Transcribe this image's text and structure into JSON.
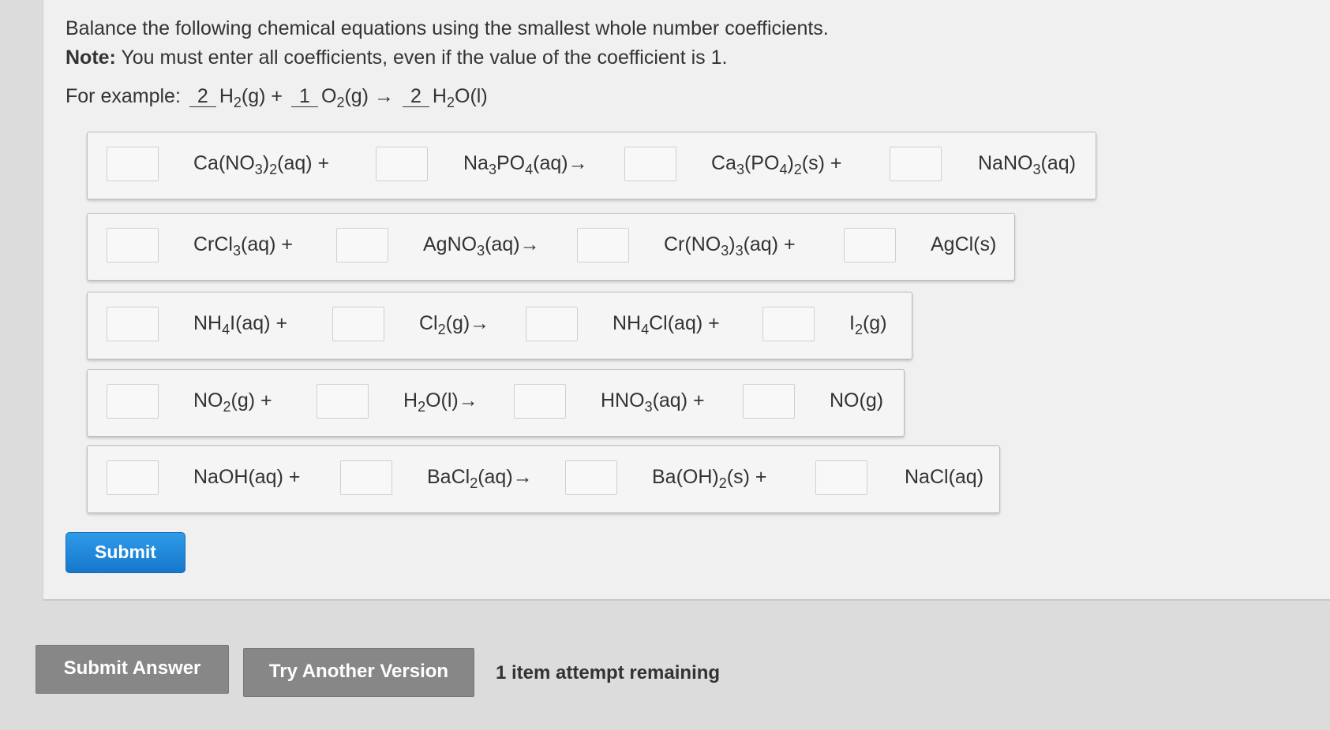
{
  "instructions": {
    "line1": "Balance the following chemical equations using the smallest whole number coefficients.",
    "note_label": "Note:",
    "note_text": " You must enter all coefficients, even if the value of the coefficient is 1."
  },
  "example": {
    "label": "For example:",
    "c1": "2",
    "s1_a": "H",
    "s1_sub": "2",
    "s1_b": "(g) +",
    "c2": "1",
    "s2_a": "O",
    "s2_sub": "2",
    "s2_b": "(g)",
    "arrow": "→",
    "c3": "2",
    "s3_a": "H",
    "s3_sub": "2",
    "s3_b": "O(l)"
  },
  "equations": [
    {
      "r1": "Ca(NO3)2(aq) +",
      "r2": "Na3PO4(aq)→",
      "p1": "Ca3(PO4)2(s) +",
      "p2": "NaNO3(aq)"
    },
    {
      "r1": "CrCl3(aq) +",
      "r2": "AgNO3(aq)→",
      "p1": "Cr(NO3)3(aq) +",
      "p2": "AgCl(s)"
    },
    {
      "r1": "NH4I(aq) +",
      "r2": "Cl2(g)→",
      "p1": "NH4Cl(aq) +",
      "p2": "I2(g)"
    },
    {
      "r1": "NO2(g) +",
      "r2": "H2O(l)→",
      "p1": "HNO3(aq) +",
      "p2": "NO(g)"
    },
    {
      "r1": "NaOH(aq) +",
      "r2": "BaCl2(aq)→",
      "p1": "Ba(OH)2(s) +",
      "p2": "NaCl(aq)"
    }
  ],
  "buttons": {
    "submit": "Submit",
    "submit_answer": "Submit Answer",
    "try_another": "Try Another Version"
  },
  "attempts_text": "1 item attempt remaining"
}
